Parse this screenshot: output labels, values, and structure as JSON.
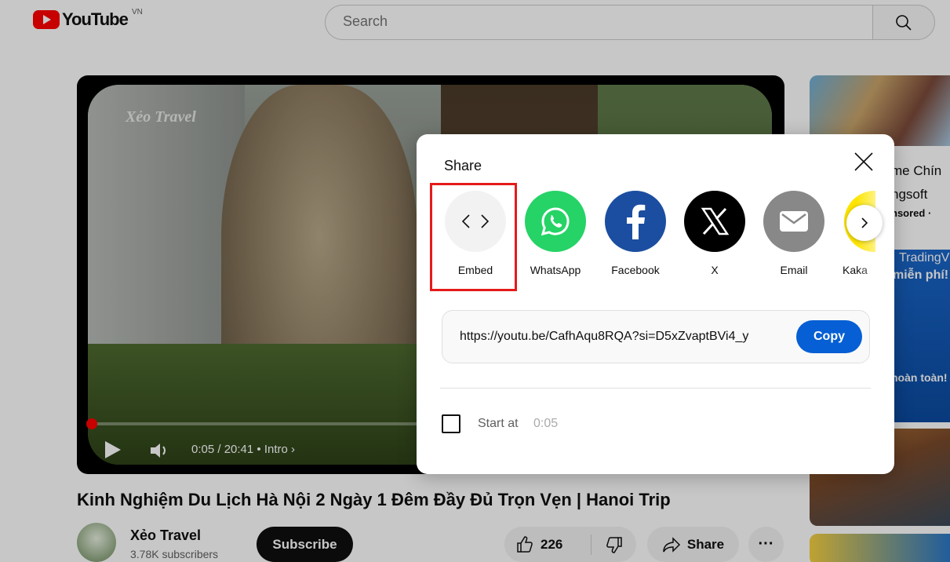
{
  "header": {
    "logo_text": "YouTube",
    "region": "VN",
    "search_placeholder": "Search"
  },
  "player": {
    "watermark": "Xẻo Travel",
    "time": "0:05 / 20:41",
    "chapter": "• Intro",
    "progress_fraction": 0.004
  },
  "video": {
    "title": "Kinh Nghiệm Du Lịch Hà Nội 2 Ngày 1 Đêm Đầy Đủ Trọn Vẹn | Hanoi Trip",
    "channel": "Xẻo Travel",
    "subscribers": "3.78K subscribers",
    "subscribe_label": "Subscribe",
    "likes": "226",
    "share_label": "Share",
    "more_label": "···"
  },
  "sidebar": {
    "ad1_line1": "me Chín",
    "ad1_line2": "ngsoft",
    "ad1_line3": "nsored · ",
    "ad2_line1": "TradingV",
    "ad2_line2": "miễn phí!",
    "ad2_line3": "hoàn toàn!"
  },
  "share_dialog": {
    "title": "Share",
    "targets": [
      {
        "label": "Embed",
        "color": "#f2f2f2",
        "icon": "embed-code-icon"
      },
      {
        "label": "WhatsApp",
        "color": "#25d366",
        "icon": "whatsapp-icon"
      },
      {
        "label": "Facebook",
        "color": "#1877f2",
        "icon": "facebook-icon"
      },
      {
        "label": "X",
        "color": "#000000",
        "icon": "x-icon"
      },
      {
        "label": "Email",
        "color": "#888888",
        "icon": "email-icon"
      },
      {
        "label": "Kaka",
        "color": "#fee500",
        "icon": "kakao-icon"
      }
    ],
    "url": "https://youtu.be/CafhAqu8RQA?si=D5xZvaptBVi4_y",
    "copy_label": "Copy",
    "start_at_label": "Start at",
    "start_at_value": "0:05"
  },
  "colors": {
    "highlight": "#e61a1a",
    "copy_button": "#065fd4",
    "youtube_red": "#ff0000"
  }
}
